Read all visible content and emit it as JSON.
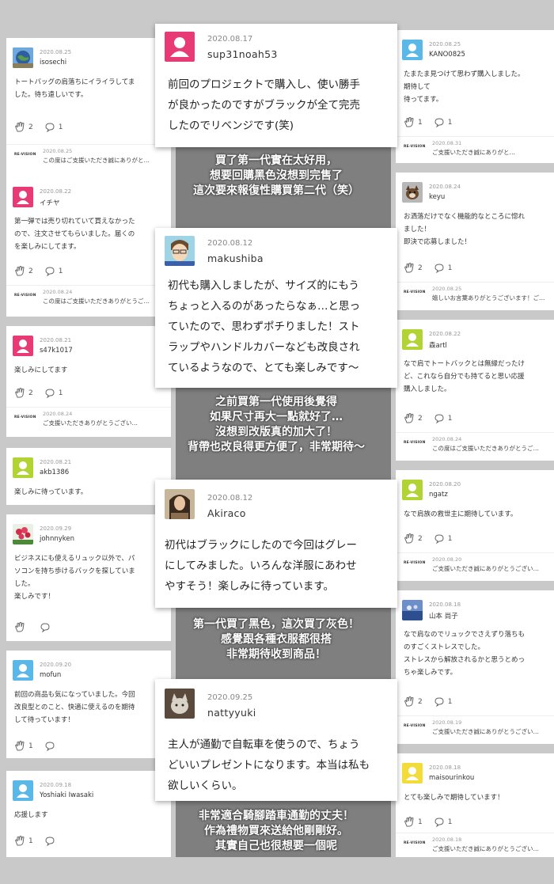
{
  "left_cards": [
    {
      "date": "2020.08.25",
      "user": "isosechi",
      "text": "トートバッグの肩落ちにイライラしてま\nした。待ち遠しいです。",
      "likes": "2",
      "comments": "1",
      "avatar": "globe",
      "reply": {
        "logo": "RE-VISION",
        "date": "2020.08.25",
        "text": "この度はご支援いただき誠にありがと…"
      }
    },
    {
      "date": "2020.08.22",
      "user": "イチヤ",
      "text": "第一弾では売り切れていて買えなかった\nので、注文させてもらいました。届くの\nを楽しみにしてます。",
      "likes": "2",
      "comments": "1",
      "avatar": "pink",
      "reply": {
        "logo": "RE-VISION",
        "date": "2020.08.24",
        "text": "この度はご支援いただきありがとうご…"
      }
    },
    {
      "date": "2020.08.21",
      "user": "s47k1017",
      "text": "楽しみにしてます",
      "likes": "2",
      "comments": "1",
      "avatar": "pink",
      "reply": {
        "logo": "RE-VISION",
        "date": "2020.08.24",
        "text": "ご支援いただきありがとうござい…"
      }
    },
    {
      "date": "2020.08.21",
      "user": "akb1386",
      "text": "楽しみに待っています。",
      "likes": "",
      "comments": "",
      "avatar": "green"
    },
    {
      "date": "2020.09.29",
      "user": "johnnyken",
      "text": "ビジネスにも使えるリュック以外で、パ\nソコンを持ち歩けるバックを探していま\nした。\n楽しみです！",
      "likes": "",
      "comments": "",
      "avatar": "flower"
    },
    {
      "date": "2020.09.20",
      "user": "mofun",
      "text": "前回の商品も気になっていました。今回\n改良型とのこと、快適に使えるのを期待\nして待っています！",
      "likes": "1",
      "comments": "",
      "avatar": "blue"
    },
    {
      "date": "2020.09.18",
      "user": "Yoshiaki Iwasaki",
      "text": "応援します",
      "likes": "1",
      "comments": "",
      "avatar": "blue"
    }
  ],
  "right_cards": [
    {
      "date": "2020.08.25",
      "user": "KANO0825",
      "text": "たまたま見つけて思わず購入しました。\n期待して\n待ってます。",
      "likes": "1",
      "comments": "1",
      "avatar": "blue",
      "reply": {
        "logo": "RE-VISION",
        "date": "2020.08.31",
        "text": "ご支援いただき誠にありがと…"
      }
    },
    {
      "date": "2020.08.24",
      "user": "keyu",
      "text": "お洒落だけでなく機能的なところに惚れ\nました！\n即決で応募しました！",
      "likes": "2",
      "comments": "1",
      "avatar": "dog",
      "reply": {
        "logo": "RE-VISION",
        "date": "2020.08.25",
        "text": "嬉しいお言葉ありがとうございます！ご…"
      }
    },
    {
      "date": "2020.08.22",
      "user": "森artl",
      "text": "なで肩でトートバックとは無縁だったけ\nど、これなら自分でも持てると思い応援\n購入しました。",
      "likes": "2",
      "comments": "1",
      "avatar": "green",
      "reply": {
        "logo": "RE-VISION",
        "date": "2020.08.24",
        "text": "この度はご支援いただきありがとうご…"
      }
    },
    {
      "date": "2020.08.20",
      "user": "ngatz",
      "text": "なで肩族の救世主に期待しています。",
      "likes": "2",
      "comments": "1",
      "avatar": "green",
      "reply": {
        "logo": "RE-VISION",
        "date": "2020.08.20",
        "text": "ご支援いただき誠にありがとうござい…"
      }
    },
    {
      "date": "2020.08.18",
      "user": "山本 尚子",
      "text": "なで肩なのでリュックでさえずり落ちも\nのすごくストレスでした。\nストレスから解放されるかと思うとめっ\nちゃ楽しみです。",
      "likes": "2",
      "comments": "1",
      "avatar": "photo",
      "reply": {
        "logo": "RE-VISION",
        "date": "2020.08.19",
        "text": "ご支援いただき誠にありがとうござい…"
      }
    },
    {
      "date": "2020.08.18",
      "user": "maisourinkou",
      "text": "とても楽しみで期待しています！",
      "likes": "1",
      "comments": "1",
      "avatar": "yellow",
      "reply": {
        "logo": "RE-VISION",
        "date": "2020.08.18",
        "text": "ご支援いただき誠にありがとうござい…"
      }
    }
  ],
  "highlights": [
    {
      "date": "2020.08.17",
      "user": "sup31noah53",
      "text": "前回のプロジェクトで購入し、使い勝手\nが良かったのですがブラックが全て完売\nしたのでリベンジです(笑)",
      "avatar": "pink",
      "caption": "買了第一代實在太好用，\n想要回購黑色沒想到完售了\n這次要來報復性購買第二代（笑）"
    },
    {
      "date": "2020.08.12",
      "user": "makushiba",
      "text": "初代も購入しましたが、サイズ的にもう\nちょっと入るのがあったらなぁ…と思っ\nていたので、思わずポチりました！スト\nラップやハンドルカバーなども改良され\nているようなので、とても楽しみです〜",
      "avatar": "cartoon",
      "caption": "之前買第一代使用後覺得\n如果尺寸再大一點就好了…\n沒想到改版真的加大了！\n背帶也改良得更方便了，非常期待〜"
    },
    {
      "date": "2020.08.12",
      "user": "Akiraco",
      "text": "初代はブラックにしたので今回はグレー\nにしてみました。いろんな洋服にあわせ\nやすそう！楽しみに待っています。",
      "avatar": "woman",
      "caption": "第一代買了黑色，這次買了灰色！\n感覺跟各種衣服都很搭\n非常期待收到商品！"
    },
    {
      "date": "2020.09.25",
      "user": "nattyyuki",
      "text": "主人が通勤で自転車を使うので、ちょう\nどいいプレゼントになります。本当は私も\n欲しいくらい。",
      "avatar": "cat",
      "caption": "非常適合騎腳踏車通勤的丈夫！\n作為禮物買來送給他剛剛好。\n其實自己也很想要一個呢"
    }
  ],
  "colors": {
    "pink": "#e83a74",
    "green": "#b2d334",
    "blue": "#5ab8e8",
    "background": "#c9c9c9",
    "strip": "#7f7f7f"
  }
}
